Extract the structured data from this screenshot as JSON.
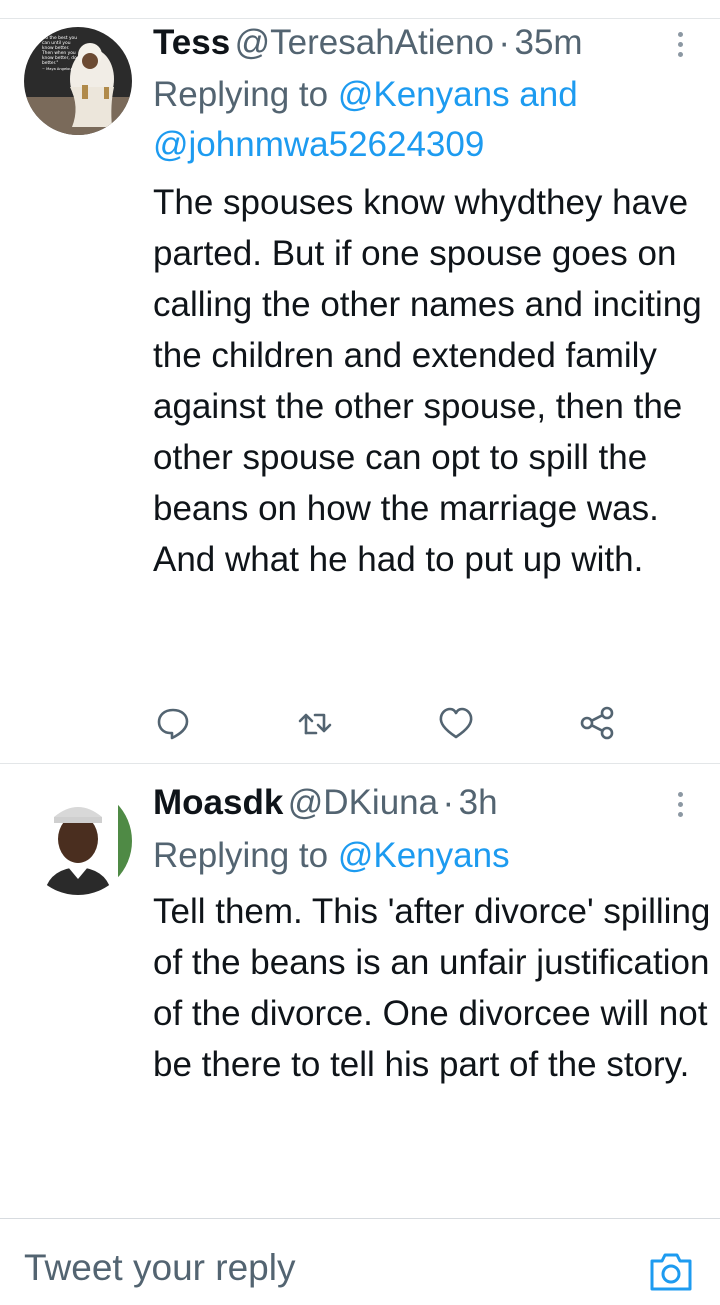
{
  "tweets": [
    {
      "name": "Tess",
      "handle": "@TeresahAtieno",
      "separator": "·",
      "time": "35m",
      "reply_prefix": "Replying to",
      "reply_mentions": "@Kenyans and @johnmwa52624309",
      "text": "The spouses know whydthey have parted. But if one spouse goes on calling the other names and inciting the children and extended family against the other spouse, then the other spouse can opt to spill the beans on how the marriage was. And what he had to put up with.",
      "avatar_quote": "Do the best you can until you know better. Then when you know better, do better. ~ Maya Angelou"
    },
    {
      "name": "Moasdk",
      "handle": "@DKiuna",
      "separator": "·",
      "time": "3h",
      "reply_prefix": "Replying to",
      "reply_mentions": "@Kenyans",
      "text": "Tell them. This 'after divorce' spilling of the beans is an unfair justification of the divorce. One divorcee will not be there to tell his part of the story."
    }
  ],
  "icons": {
    "reply": "reply-icon",
    "retweet": "retweet-icon",
    "like": "heart-icon",
    "share": "share-icon",
    "more": "more-icon",
    "camera": "camera-icon"
  },
  "compose": {
    "placeholder": "Tweet your reply"
  },
  "colors": {
    "accent": "#1d9bf0",
    "secondary_text": "#536471",
    "icon": "#536471"
  }
}
